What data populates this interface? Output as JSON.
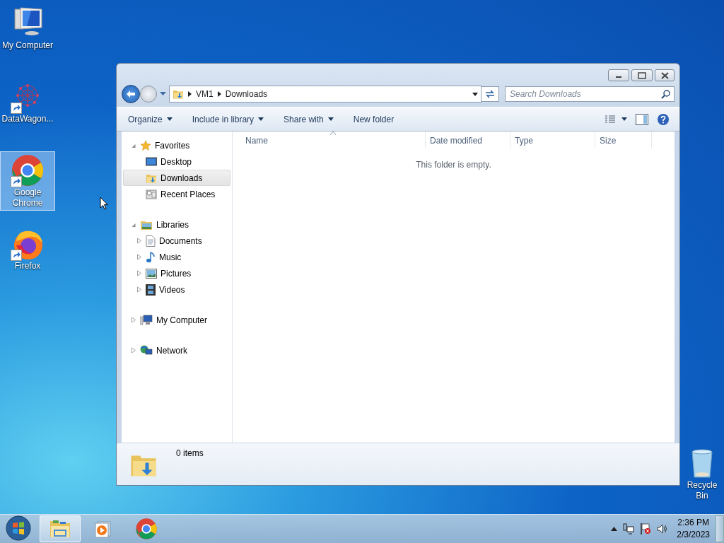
{
  "desktop_icons": [
    {
      "kind": "computer",
      "label": "My Computer",
      "selected": false,
      "shortcut": false
    },
    {
      "kind": "molecule",
      "label": "DataWagon...",
      "selected": false,
      "shortcut": true
    },
    {
      "kind": "chrome",
      "label": "Google Chrome",
      "selected": true,
      "shortcut": true
    },
    {
      "kind": "firefox",
      "label": "Firefox",
      "selected": false,
      "shortcut": true
    },
    {
      "kind": "recycle",
      "label": "Recycle Bin",
      "selected": false,
      "shortcut": false
    }
  ],
  "window": {
    "breadcrumb": [
      "VM1",
      "Downloads"
    ],
    "search": {
      "placeholder": "Search Downloads"
    },
    "toolbar": [
      {
        "label": "Organize",
        "dropdown": true
      },
      {
        "label": "Include in library",
        "dropdown": true
      },
      {
        "label": "Share with",
        "dropdown": true
      },
      {
        "label": "New folder",
        "dropdown": false
      }
    ],
    "nav": [
      {
        "kind": "favorites",
        "label": "Favorites",
        "expanded": true,
        "children": [
          {
            "kind": "desktop",
            "label": "Desktop",
            "selected": false
          },
          {
            "kind": "downloads",
            "label": "Downloads",
            "selected": true
          },
          {
            "kind": "recent",
            "label": "Recent Places",
            "selected": false
          }
        ]
      },
      {
        "kind": "libraries",
        "label": "Libraries",
        "expanded": true,
        "children": [
          {
            "kind": "documents",
            "label": "Documents",
            "selected": false,
            "expanded": false
          },
          {
            "kind": "music",
            "label": "Music",
            "selected": false,
            "expanded": false
          },
          {
            "kind": "pictures",
            "label": "Pictures",
            "selected": false,
            "expanded": false
          },
          {
            "kind": "videos",
            "label": "Videos",
            "selected": false,
            "expanded": false
          }
        ]
      },
      {
        "kind": "computer",
        "label": "My Computer",
        "expanded": false
      },
      {
        "kind": "network",
        "label": "Network",
        "expanded": false
      }
    ],
    "columns": [
      "Name",
      "Date modified",
      "Type",
      "Size"
    ],
    "empty_message": "This folder is empty.",
    "status": "0 items"
  },
  "taskbar": {
    "items": [
      {
        "kind": "explorer",
        "active": true
      },
      {
        "kind": "media",
        "active": false
      },
      {
        "kind": "chrome",
        "active": false
      }
    ],
    "time": "2:36 PM",
    "date": "2/3/2023"
  }
}
